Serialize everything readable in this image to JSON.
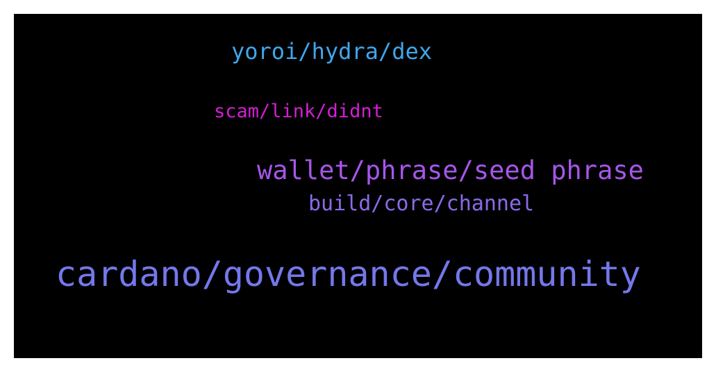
{
  "terms": [
    {
      "text": "yoroi/hydra/dex",
      "color": "#3fa7ec"
    },
    {
      "text": "scam/link/didnt",
      "color": "#d21fd3"
    },
    {
      "text": "wallet/phrase/seed phrase",
      "color": "#a656ea"
    },
    {
      "text": "build/core/channel",
      "color": "#8b6ae8"
    },
    {
      "text": "cardano/governance/community",
      "color": "#7478ea"
    }
  ]
}
